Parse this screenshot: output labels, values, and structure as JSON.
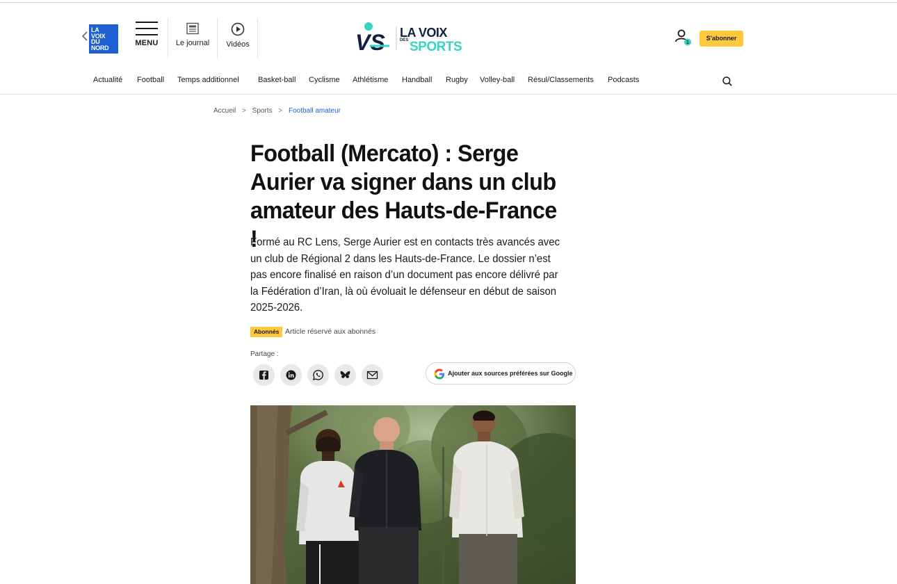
{
  "header": {
    "lvdn_logo_lines": [
      "LA",
      "VOIX",
      "DU",
      "NORD"
    ],
    "menu_label": "MENU",
    "journal_label": "Le journal",
    "videos_label": "Vidéos",
    "vs_logo": {
      "monogram": "VS",
      "line1": "LA VOIX",
      "small": "DES",
      "line2": "SPORTS"
    },
    "notification_count": "1",
    "subscribe_label": "S'abonner"
  },
  "nav": {
    "items": [
      "Actualité",
      "Football",
      "Temps additionnel",
      "Basket-ball",
      "Cyclisme",
      "Athlétisme",
      "Handball",
      "Rugby",
      "Volley-ball",
      "Résul/Classements",
      "Podcasts"
    ]
  },
  "breadcrumb": {
    "items": [
      "Accueil",
      "Sports",
      "Football amateur"
    ],
    "separator": ">"
  },
  "article": {
    "headline": "Football (Mercato) : Serge Aurier va signer dans un club amateur des Hauts-de-France !",
    "lead": "Formé au RC Lens, Serge Aurier est en contacts très avancés avec un club de Régional 2 dans les Hauts-de-France. Le dossier n’est pas encore finalisé en raison d’un document pas encore délivré par la Fédération d’Iran, là où évoluait le défenseur en début de saison 2025-2026.",
    "badge": "Abonnés",
    "badge_text": "Article réservé aux abonnés",
    "share_label": "Partage :",
    "share_icons": [
      "facebook-icon",
      "linkedin-icon",
      "whatsapp-icon",
      "bluesky-icon",
      "mail-icon"
    ],
    "google_sources_label": "Ajouter aux sources préférées sur Google"
  },
  "colors": {
    "brand_blue": "#1e5fd4",
    "subscribe_yellow": "#ffc83d",
    "vs_teal": "#35d5c0",
    "vs_navy": "#12213f"
  }
}
